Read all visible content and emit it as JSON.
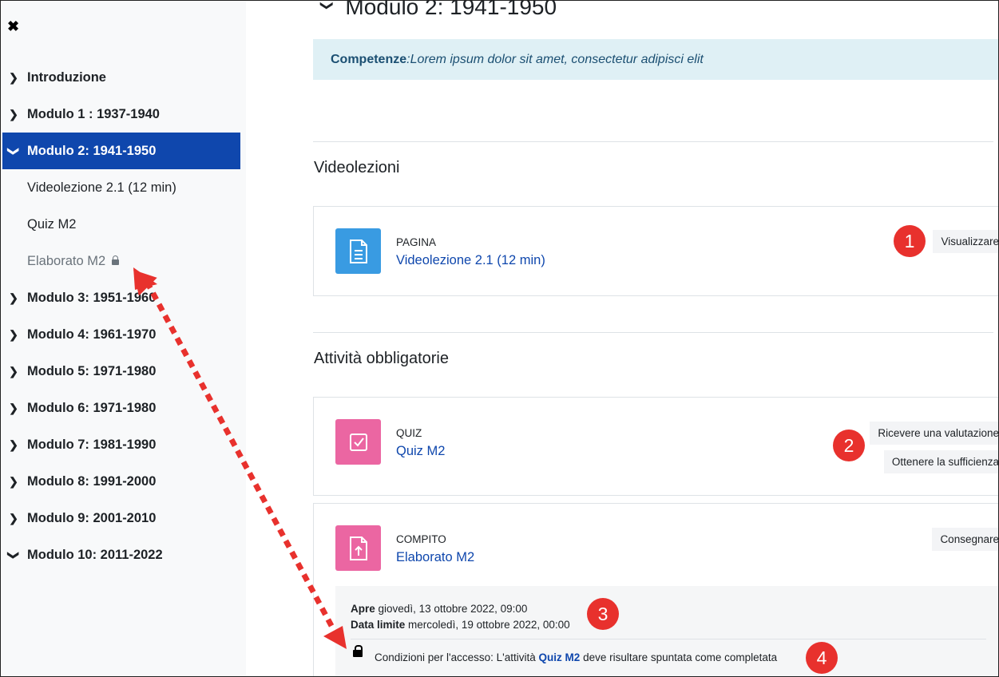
{
  "sidebar": {
    "close_icon": "close-icon",
    "items": [
      {
        "label": "Introduzione",
        "expanded": false
      },
      {
        "label": "Modulo 1 : 1937-1940",
        "expanded": false
      },
      {
        "label": "Modulo 2: 1941-1950",
        "expanded": true,
        "active": true
      },
      {
        "label": "Modulo 3: 1951-1960",
        "expanded": false
      },
      {
        "label": "Modulo 4: 1961-1970",
        "expanded": false
      },
      {
        "label": "Modulo 5: 1971-1980",
        "expanded": false
      },
      {
        "label": "Modulo 6: 1971-1980",
        "expanded": false
      },
      {
        "label": "Modulo 7: 1981-1990",
        "expanded": false
      },
      {
        "label": "Modulo 8: 1991-2000",
        "expanded": false
      },
      {
        "label": "Modulo 9: 2001-2010",
        "expanded": false
      },
      {
        "label": "Modulo 10: 2011-2022",
        "expanded": true
      }
    ],
    "subitems": [
      {
        "label": "Videolezione 2.1 (12 min)"
      },
      {
        "label": "Quiz M2"
      },
      {
        "label": "Elaborato M2",
        "locked": true
      }
    ]
  },
  "main": {
    "module_title": "Modulo 2: 1941-1950",
    "competenze_label": "Competenze",
    "competenze_text": ":Lorem ipsum dolor sit amet, consectetur adipisci elit",
    "sections": [
      {
        "title": "Videolezioni"
      },
      {
        "title": "Attività obbligatorie"
      }
    ],
    "activities": [
      {
        "type": "PAGINA",
        "name": "Videolezione 2.1 (12 min)",
        "badges": [
          "Visualizzare"
        ],
        "icon": "page-icon",
        "color": "#399be2"
      },
      {
        "type": "QUIZ",
        "name": "Quiz M2",
        "badges": [
          "Ricevere una valutazione",
          "Ottenere la sufficienza"
        ],
        "icon": "quiz-icon",
        "color": "#eb66a2"
      },
      {
        "type": "COMPITO",
        "name": "Elaborato M2",
        "badges": [
          "Consegnare"
        ],
        "icon": "assignment-icon",
        "color": "#eb66a2"
      }
    ],
    "dates": {
      "open_label": "Apre",
      "open_value": "giovedì, 13 ottobre 2022, 09:00",
      "due_label": "Data limite",
      "due_value": "mercoledì, 19 ottobre 2022, 00:00"
    },
    "restriction": {
      "prefix": "Condizioni per l'accesso: L'attività",
      "link": "Quiz M2",
      "suffix": "deve risultare spuntata come completata"
    }
  },
  "callouts": [
    "1",
    "2",
    "3",
    "4"
  ],
  "colors": {
    "active_nav": "#0f47ad",
    "link": "#0f47ad",
    "callout": "#e8312d",
    "competenze_bg": "#dff0f5"
  }
}
